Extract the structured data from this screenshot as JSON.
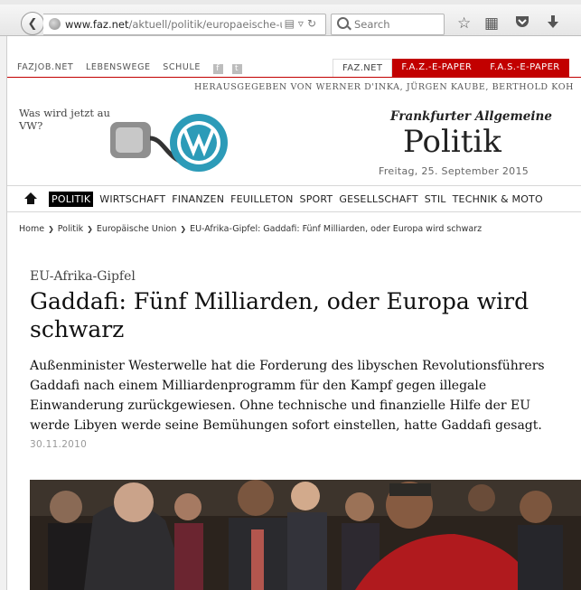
{
  "browser": {
    "url_domain": "www.faz.net",
    "url_path": "/aktuell/politik/europaeische-union",
    "search_placeholder": "Search"
  },
  "site_nav": {
    "top_links": [
      "FAZJOB.NET",
      "LEBENSWEGE",
      "SCHULE"
    ],
    "tabs": [
      "FAZ.NET",
      "F.A.Z.-E-PAPER",
      "F.A.S.-E-PAPER"
    ],
    "publishers": "HERAUSGEGEBEN VON WERNER D'INKA, JÜRGEN KAUBE, BERTHOLD KOH"
  },
  "ad": {
    "text": "Was wird jetzt aus VW?"
  },
  "masthead": {
    "name": "Frankfurter Allgemeine",
    "section": "Politik",
    "date": "Freitag, 25. September 2015"
  },
  "main_nav": {
    "items": [
      "POLITIK",
      "WIRTSCHAFT",
      "FINANZEN",
      "FEUILLETON",
      "SPORT",
      "GESELLSCHAFT",
      "STIL",
      "TECHNIK & MOTO"
    ]
  },
  "breadcrumb": [
    "Home",
    "Politik",
    "Europäische Union",
    "EU-Afrika-Gipfel: Gaddafi: Fünf Milliarden, oder Europa wird schwarz"
  ],
  "article": {
    "kicker": "EU-Afrika-Gipfel",
    "title": "Gaddafi: Fünf Milliarden, oder Europa wird schwarz",
    "teaser": "Außenminister Westerwelle hat die Forderung des libyschen Revolutionsführers Gaddafi nach einem Milliardenprogramm für den Kampf gegen illegale Einwanderung zurückgewiesen. Ohne technische und finanzielle Hilfe der EU werde Libyen werde seine Bemühungen sofort einstellen, hatte Gaddafi gesagt.",
    "date": "30.11.2010"
  },
  "colors": {
    "brand_red": "#c20000",
    "nav_active": "#000000"
  },
  "icons": [
    "back-arrow-icon",
    "globe-icon",
    "reader-view-icon",
    "dropdown-icon",
    "reload-icon",
    "search-icon",
    "bookmark-star-icon",
    "bookmarks-list-icon",
    "pocket-icon",
    "download-icon",
    "facebook-icon",
    "twitter-icon",
    "home-icon"
  ]
}
